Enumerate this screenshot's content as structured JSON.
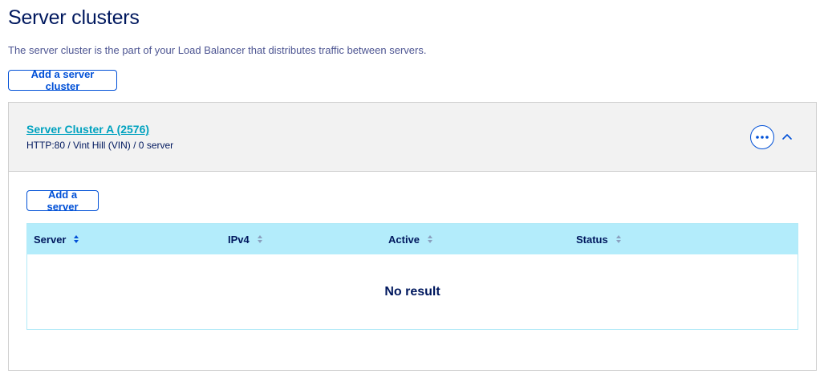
{
  "page": {
    "title": "Server clusters",
    "description": "The server cluster is the part of your Load Balancer that distributes traffic between servers.",
    "add_cluster_label": "Add a server cluster"
  },
  "cluster": {
    "name": "Server Cluster A (2576)",
    "meta": "HTTP:80 / Vint Hill (VIN) / 0 server",
    "add_server_label": "Add a server",
    "actions_icon": "ellipsis-icon",
    "collapse_icon": "chevron-up-icon"
  },
  "table": {
    "columns": [
      {
        "label": "Server",
        "sorted": true
      },
      {
        "label": "IPv4",
        "sorted": false
      },
      {
        "label": "Active",
        "sorted": false
      },
      {
        "label": "Status",
        "sorted": false
      }
    ],
    "empty_text": "No result"
  },
  "colors": {
    "primary": "#0050d7",
    "link": "#00a2bf",
    "heading": "#00185e",
    "table_header_bg": "#b3ecfb",
    "panel_header_bg": "#f2f2f2"
  }
}
